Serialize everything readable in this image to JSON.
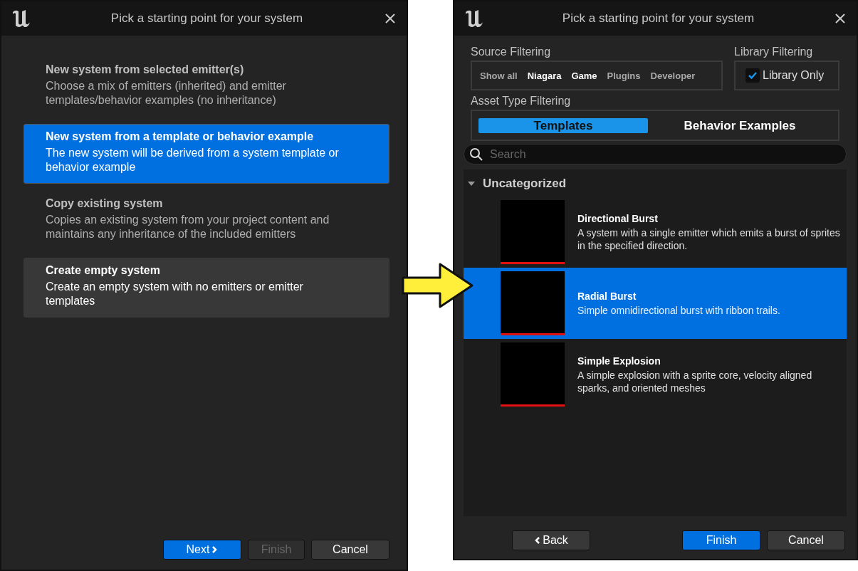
{
  "left_window": {
    "title": "Pick a starting point for your system",
    "options": [
      {
        "title": "New system from selected emitter(s)",
        "description": "Choose a mix of emitters (inherited) and emitter templates/behavior examples (no inheritance)",
        "selected": false,
        "hovered": false
      },
      {
        "title": "New system from a template or behavior example",
        "description": "The new system will be derived from a system template or behavior example",
        "selected": true,
        "hovered": false
      },
      {
        "title": "Copy existing system",
        "description": "Copies an existing system from your project content and maintains any inheritance of the included emitters",
        "selected": false,
        "hovered": false
      },
      {
        "title": "Create empty system",
        "description": "Create an empty system with no emitters or emitter templates",
        "selected": false,
        "hovered": true
      }
    ],
    "buttons": [
      {
        "label": "Next",
        "kind": "next",
        "disabled": false
      },
      {
        "label": "Finish",
        "kind": "primary",
        "disabled": true
      },
      {
        "label": "Cancel",
        "kind": "plain",
        "disabled": false
      }
    ]
  },
  "right_window": {
    "title": "Pick a starting point for your system",
    "source_filtering": {
      "label": "Source Filtering",
      "options": [
        {
          "label": "Show all",
          "selected": false
        },
        {
          "label": "Niagara",
          "selected": true
        },
        {
          "label": "Game",
          "selected": true
        },
        {
          "label": "Plugins",
          "selected": false
        },
        {
          "label": "Developer",
          "selected": false
        }
      ]
    },
    "library_filtering": {
      "label": "Library Filtering",
      "checkbox": {
        "label": "Library Only",
        "checked": true
      }
    },
    "asset_type_filtering": {
      "label": "Asset Type Filtering",
      "tabs": [
        {
          "label": "Templates",
          "selected": true
        },
        {
          "label": "Behavior Examples",
          "selected": false
        }
      ]
    },
    "search": {
      "placeholder": "Search"
    },
    "category": {
      "label": "Uncategorized",
      "expanded": true,
      "items": [
        {
          "name": "Directional Burst",
          "description": "A system with a single emitter which emits a burst of sprites in the specified direction.",
          "selected": false
        },
        {
          "name": "Radial Burst",
          "description": "Simple omnidirectional burst with ribbon trails.",
          "selected": true
        },
        {
          "name": "Simple Explosion",
          "description": "A simple explosion with a sprite core, velocity aligned sparks, and oriented meshes",
          "selected": false
        }
      ]
    },
    "buttons": [
      {
        "label": "Back",
        "kind": "back",
        "disabled": false
      },
      {
        "label": "Finish",
        "kind": "primary",
        "disabled": false
      },
      {
        "label": "Cancel",
        "kind": "plain",
        "disabled": false
      }
    ]
  }
}
